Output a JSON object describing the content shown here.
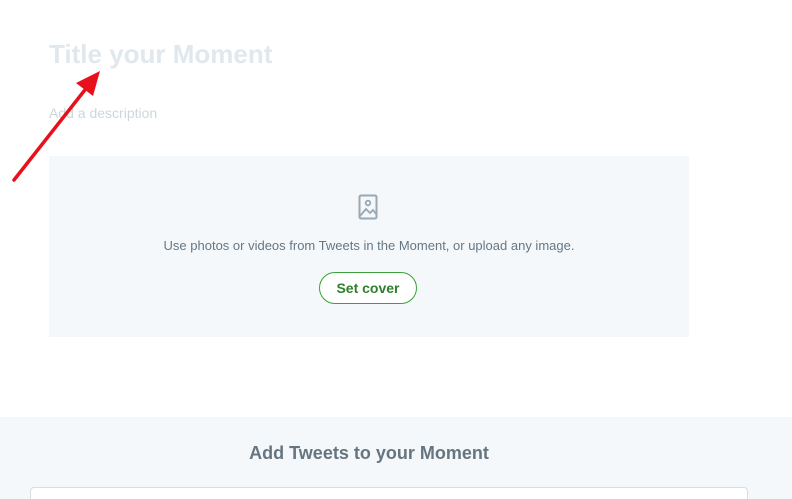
{
  "moment": {
    "title_placeholder": "Title your Moment",
    "description_placeholder": "Add a description"
  },
  "cover": {
    "icon": "photo-icon",
    "hint_text": "Use photos or videos from Tweets in the Moment, or upload any image.",
    "set_cover_label": "Set cover"
  },
  "tweets": {
    "heading": "Add Tweets to your Moment"
  },
  "colors": {
    "accent_green": "#2f7f2d",
    "annotation_arrow": "#e8111b",
    "panel_bg": "#f5f8fa"
  }
}
